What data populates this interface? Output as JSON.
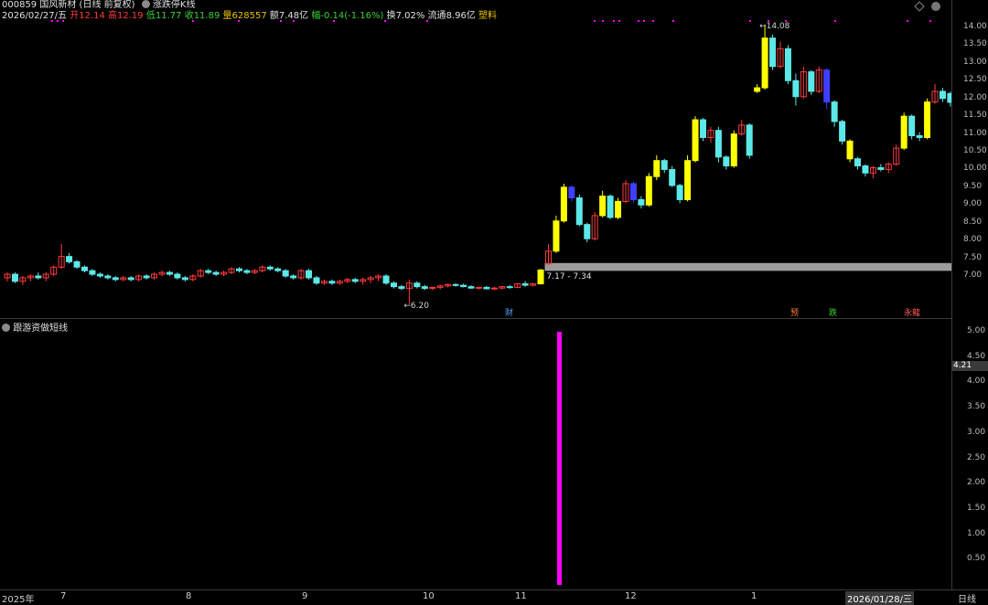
{
  "header": {
    "code_name": "000859 国风新材",
    "period": "(日线 前复权)",
    "indicator": "涨跌停K线",
    "date": "2026/02/27/五",
    "open_label": "开",
    "open": "12.14",
    "high_label": "高",
    "high": "12.19",
    "low_label": "低",
    "low": "11.77",
    "close_label": "收",
    "close": "11.89",
    "volume_label": "量",
    "volume": "628557",
    "amount_label": "额",
    "amount": "7.48亿",
    "change_label": "幅",
    "change": "-0.14(-1.16%)",
    "turnover_label": "换",
    "turnover": "7.02%",
    "float_label": "流通",
    "float": "8.96亿",
    "sector": "塑料"
  },
  "sub_panel": {
    "title": "跟游资做短线",
    "current_value": "4.21"
  },
  "price_axis": [
    "14.00",
    "13.50",
    "13.00",
    "12.50",
    "12.00",
    "11.50",
    "11.00",
    "10.50",
    "10.00",
    "9.50",
    "9.00",
    "8.50",
    "8.00",
    "7.50",
    "7.00"
  ],
  "sub_axis": [
    "5.00",
    "4.50",
    "4.00",
    "3.50",
    "3.00",
    "2.50",
    "2.00",
    "1.50",
    "1.00",
    "0.50"
  ],
  "x_axis": [
    "2025年",
    "7",
    "8",
    "9",
    "10",
    "11",
    "12",
    "1",
    "2026/01/28/三"
  ],
  "period_button": "日线",
  "annotations": {
    "high_label": "14.08",
    "low_label": "6.20",
    "range_label": "7.17 - 7.34",
    "flag_cai": "财",
    "flag_yu": "预",
    "flag_die": "跌",
    "flag_long": "永龍"
  },
  "colors": {
    "up": "#ff3b3b",
    "down": "#5ce8e8",
    "limit_up": "#ffff00",
    "limit_down": "#3f3fff",
    "signal": "#ff00ff"
  },
  "chart_data": {
    "type": "candlestick",
    "price_range": [
      6.5,
      14.3
    ],
    "signal_bar": {
      "value": 5.0
    },
    "sub_range": [
      0,
      5.3
    ],
    "gap_band": [
      7.17,
      7.34
    ],
    "candles": [
      [
        6.95,
        7.1,
        6.85,
        7.05
      ],
      [
        7.05,
        7.1,
        6.8,
        6.85
      ],
      [
        6.85,
        7.0,
        6.75,
        6.95
      ],
      [
        6.95,
        7.05,
        6.85,
        7.0
      ],
      [
        7.0,
        7.1,
        6.9,
        6.95
      ],
      [
        6.95,
        7.1,
        6.85,
        7.05
      ],
      [
        7.05,
        7.3,
        7.0,
        7.25
      ],
      [
        7.25,
        7.9,
        7.2,
        7.55
      ],
      [
        7.55,
        7.65,
        7.35,
        7.4
      ],
      [
        7.4,
        7.45,
        7.2,
        7.25
      ],
      [
        7.25,
        7.3,
        7.1,
        7.15
      ],
      [
        7.15,
        7.2,
        7.0,
        7.05
      ],
      [
        7.05,
        7.1,
        6.95,
        7.0
      ],
      [
        7.0,
        7.05,
        6.9,
        6.95
      ],
      [
        6.95,
        7.0,
        6.85,
        6.9
      ],
      [
        6.9,
        7.0,
        6.85,
        6.95
      ],
      [
        6.95,
        7.0,
        6.85,
        6.9
      ],
      [
        6.9,
        7.05,
        6.85,
        7.0
      ],
      [
        7.0,
        7.05,
        6.9,
        6.95
      ],
      [
        6.95,
        7.1,
        6.9,
        7.05
      ],
      [
        7.05,
        7.15,
        7.0,
        7.1
      ],
      [
        7.1,
        7.15,
        7.0,
        7.05
      ],
      [
        7.05,
        7.1,
        6.9,
        6.95
      ],
      [
        6.95,
        7.0,
        6.85,
        6.9
      ],
      [
        6.9,
        7.05,
        6.85,
        7.0
      ],
      [
        7.0,
        7.2,
        6.95,
        7.15
      ],
      [
        7.15,
        7.2,
        7.05,
        7.1
      ],
      [
        7.1,
        7.15,
        7.0,
        7.05
      ],
      [
        7.05,
        7.15,
        7.0,
        7.1
      ],
      [
        7.1,
        7.25,
        7.05,
        7.2
      ],
      [
        7.2,
        7.25,
        7.1,
        7.15
      ],
      [
        7.15,
        7.2,
        7.05,
        7.1
      ],
      [
        7.1,
        7.2,
        7.05,
        7.15
      ],
      [
        7.15,
        7.3,
        7.1,
        7.25
      ],
      [
        7.25,
        7.3,
        7.15,
        7.2
      ],
      [
        7.2,
        7.25,
        7.1,
        7.15
      ],
      [
        7.15,
        7.2,
        6.95,
        7.0
      ],
      [
        7.0,
        7.05,
        6.9,
        6.95
      ],
      [
        6.95,
        7.2,
        6.9,
        7.15
      ],
      [
        7.15,
        7.2,
        6.9,
        6.95
      ],
      [
        6.95,
        7.0,
        6.75,
        6.8
      ],
      [
        6.8,
        6.9,
        6.75,
        6.85
      ],
      [
        6.85,
        6.9,
        6.75,
        6.8
      ],
      [
        6.8,
        6.9,
        6.75,
        6.85
      ],
      [
        6.85,
        6.95,
        6.8,
        6.9
      ],
      [
        6.9,
        6.95,
        6.8,
        6.85
      ],
      [
        6.85,
        6.95,
        6.75,
        6.9
      ],
      [
        6.9,
        7.0,
        6.8,
        6.95
      ],
      [
        6.95,
        7.05,
        6.85,
        7.0
      ],
      [
        7.0,
        7.05,
        6.75,
        6.8
      ],
      [
        6.8,
        6.85,
        6.65,
        6.7
      ],
      [
        6.7,
        6.75,
        6.6,
        6.65
      ],
      [
        6.65,
        6.9,
        6.2,
        6.8
      ],
      [
        6.8,
        6.85,
        6.65,
        6.7
      ],
      [
        6.7,
        6.75,
        6.6,
        6.65
      ],
      [
        6.65,
        6.7,
        6.6,
        6.68
      ],
      [
        6.68,
        6.75,
        6.62,
        6.72
      ],
      [
        6.72,
        6.8,
        6.68,
        6.76
      ],
      [
        6.76,
        6.8,
        6.7,
        6.74
      ],
      [
        6.74,
        6.78,
        6.68,
        6.7
      ],
      [
        6.7,
        6.74,
        6.64,
        6.66
      ],
      [
        6.66,
        6.7,
        6.62,
        6.68
      ],
      [
        6.68,
        6.72,
        6.62,
        6.64
      ],
      [
        6.64,
        6.7,
        6.6,
        6.66
      ],
      [
        6.66,
        6.72,
        6.62,
        6.7
      ],
      [
        6.7,
        6.75,
        6.64,
        6.68
      ],
      [
        6.68,
        6.8,
        6.66,
        6.78
      ],
      [
        6.78,
        6.86,
        6.7,
        6.74
      ],
      [
        6.74,
        6.8,
        6.7,
        6.78
      ],
      [
        6.78,
        7.2,
        6.76,
        7.17
      ],
      [
        7.34,
        7.9,
        7.3,
        7.7
      ],
      [
        7.7,
        8.7,
        7.65,
        8.55
      ],
      [
        8.55,
        9.6,
        8.5,
        9.5
      ],
      [
        9.5,
        9.55,
        9.1,
        9.2
      ],
      [
        9.2,
        9.3,
        8.4,
        8.45
      ],
      [
        8.45,
        8.5,
        7.95,
        8.05
      ],
      [
        8.05,
        8.8,
        8.0,
        8.7
      ],
      [
        8.7,
        9.4,
        8.65,
        9.25
      ],
      [
        9.25,
        9.3,
        8.6,
        8.65
      ],
      [
        8.65,
        9.2,
        8.6,
        9.1
      ],
      [
        9.1,
        9.7,
        9.05,
        9.6
      ],
      [
        9.6,
        9.65,
        9.05,
        9.15
      ],
      [
        9.15,
        9.25,
        8.9,
        9.0
      ],
      [
        9.0,
        9.9,
        8.95,
        9.8
      ],
      [
        9.8,
        10.4,
        9.7,
        10.25
      ],
      [
        10.25,
        10.3,
        9.9,
        10.0
      ],
      [
        10.0,
        10.1,
        9.5,
        9.55
      ],
      [
        9.55,
        9.6,
        9.05,
        9.15
      ],
      [
        9.15,
        10.4,
        9.1,
        10.25
      ],
      [
        10.25,
        11.5,
        10.2,
        11.4
      ],
      [
        11.4,
        11.45,
        10.8,
        10.9
      ],
      [
        10.9,
        11.2,
        10.75,
        11.1
      ],
      [
        11.1,
        11.2,
        10.2,
        10.35
      ],
      [
        10.35,
        10.4,
        10.0,
        10.1
      ],
      [
        10.1,
        11.1,
        10.05,
        11.0
      ],
      [
        11.0,
        11.4,
        10.95,
        11.25
      ],
      [
        11.25,
        11.3,
        10.3,
        10.4
      ],
      [
        12.2,
        12.4,
        12.15,
        12.3
      ],
      [
        12.3,
        14.08,
        12.25,
        13.7
      ],
      [
        13.7,
        13.8,
        12.8,
        12.9
      ],
      [
        12.9,
        13.6,
        12.85,
        13.4
      ],
      [
        13.4,
        13.5,
        12.4,
        12.5
      ],
      [
        12.5,
        12.7,
        11.8,
        12.05
      ],
      [
        12.05,
        12.9,
        12.0,
        12.75
      ],
      [
        12.75,
        12.8,
        12.1,
        12.2
      ],
      [
        12.2,
        12.9,
        12.15,
        12.8
      ],
      [
        12.8,
        12.85,
        11.7,
        11.9
      ],
      [
        11.9,
        11.95,
        11.2,
        11.35
      ],
      [
        11.35,
        11.4,
        10.7,
        10.8
      ],
      [
        10.8,
        10.85,
        10.2,
        10.3
      ],
      [
        10.3,
        10.35,
        10.0,
        10.1
      ],
      [
        10.1,
        10.15,
        9.8,
        9.9
      ],
      [
        9.9,
        10.1,
        9.75,
        10.05
      ],
      [
        10.05,
        10.15,
        9.95,
        10.0
      ],
      [
        10.0,
        10.2,
        9.9,
        10.15
      ],
      [
        10.15,
        10.7,
        10.1,
        10.6
      ],
      [
        10.6,
        11.6,
        10.55,
        11.5
      ],
      [
        11.5,
        11.55,
        10.85,
        10.95
      ],
      [
        10.95,
        11.05,
        10.8,
        10.9
      ],
      [
        10.9,
        12.0,
        10.85,
        11.9
      ],
      [
        11.9,
        12.4,
        11.85,
        12.2
      ],
      [
        12.2,
        12.3,
        11.9,
        12.0
      ],
      [
        12.14,
        12.19,
        11.77,
        11.89
      ]
    ],
    "limit_up_idx": [
      69,
      71,
      72,
      77,
      79,
      83,
      84,
      88,
      89,
      94,
      97,
      98,
      109,
      116,
      119
    ],
    "limit_down_idx": [
      73,
      81,
      106
    ],
    "xlabel": "",
    "ylabel": ""
  }
}
